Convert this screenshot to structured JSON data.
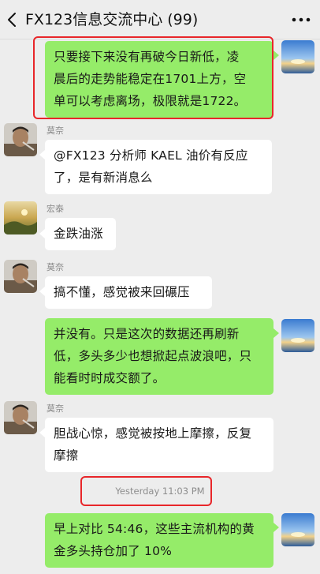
{
  "header": {
    "title": "FX123信息交流中心 (99)"
  },
  "messages": [
    {
      "sender": "",
      "direction": "out",
      "lines": [
        "只要接下来没有再破今日新低，凌",
        "晨后的走势能稳定在1701上方，空",
        "单可以考虑离场，极限就是1722。"
      ]
    },
    {
      "sender": "莫奈",
      "direction": "in",
      "lines": [
        "@FX123 分析师 KAEL  油价有反应",
        "了，是有新消息么"
      ]
    },
    {
      "sender": "宏泰",
      "direction": "in",
      "lines": [
        "金跌油涨"
      ]
    },
    {
      "sender": "莫奈",
      "direction": "in",
      "lines": [
        "搞不懂，感觉被来回碾压"
      ]
    },
    {
      "sender": "",
      "direction": "out",
      "lines": [
        "并没有。只是这次的数据还再刷新",
        "低，多头多少也想掀起点波浪吧，只",
        "能看时时成交额了。"
      ]
    },
    {
      "sender": "莫奈",
      "direction": "in",
      "lines": [
        "胆战心惊，感觉被按地上摩擦，反复",
        "摩擦"
      ]
    },
    {
      "sender": "",
      "direction": "out",
      "lines": [
        "早上对比 54:46，这些主流机构的黄",
        "金多头持仓加了 10%"
      ]
    }
  ],
  "timestamp": "Yesterday 11:03 PM",
  "icons": {
    "back": "chevron-left-icon",
    "more": "more-dots-icon"
  },
  "colors": {
    "background": "#ededed",
    "out_bubble": "#95ec69",
    "in_bubble": "#ffffff",
    "highlight": "#e8262a"
  }
}
